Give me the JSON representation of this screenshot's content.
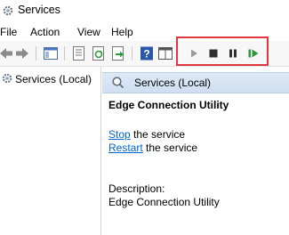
{
  "window": {
    "title": "Services",
    "icon": "gear-icon"
  },
  "menu": {
    "items": [
      "File",
      "Action",
      "View",
      "Help"
    ]
  },
  "toolbar": {
    "buttons": [
      "back-icon",
      "forward-icon",
      "console-tree-icon",
      "properties-icon",
      "refresh-icon",
      "export-icon",
      "help-icon",
      "show-hide-icon",
      "play-icon",
      "stop-icon",
      "pause-icon",
      "restart-icon"
    ],
    "highlight_color": "#e0383e"
  },
  "tree": {
    "root_label": "Services (Local)"
  },
  "details": {
    "header_label": "Services (Local)",
    "service_name": "Edge Connection Utility",
    "stop_link": "Stop",
    "stop_suffix": " the service",
    "restart_link": "Restart",
    "restart_suffix": " the service",
    "description_label": "Description:",
    "description_text": "Edge Connection Utility"
  }
}
